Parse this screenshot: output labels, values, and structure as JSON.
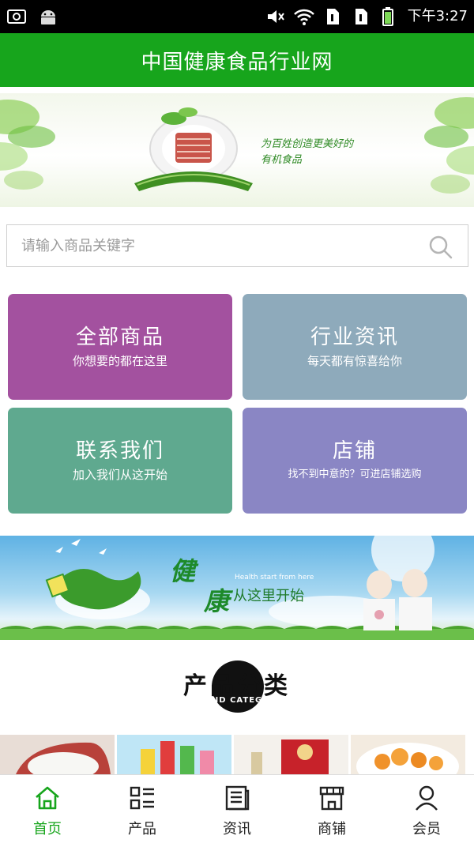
{
  "status_bar": {
    "time": "下午3:27",
    "icons": [
      "screenshot-icon",
      "android-icon",
      "mute-icon",
      "wifi-icon",
      "sim1-icon",
      "sim2-icon",
      "battery-icon"
    ]
  },
  "header": {
    "title": "中国健康食品行业网"
  },
  "banner_top": {
    "slogan_line1": "为百姓创造更美好的",
    "slogan_line2": "有机食品"
  },
  "search": {
    "placeholder": "请输入商品关键字",
    "value": ""
  },
  "tiles": [
    {
      "title": "全部商品",
      "subtitle": "你想要的都在这里",
      "color": "#a3519f"
    },
    {
      "title": "行业资讯",
      "subtitle": "每天都有惊喜给你",
      "color": "#8eaabb"
    },
    {
      "title": "联系我们",
      "subtitle": "加入我们从这开始",
      "color": "#5fa98f"
    },
    {
      "title": "店铺",
      "subtitle": "找不到中意的？可进店铺选购",
      "color": "#8a86c4"
    }
  ],
  "banner_mid": {
    "char1": "健",
    "char2": "康",
    "tagline": "从这里开始",
    "small_text": "Health start from here"
  },
  "category": {
    "title": "产品分类",
    "subtitle": "BRAND CATEGORY"
  },
  "bottom_nav": [
    {
      "label": "首页",
      "icon": "home-icon",
      "active": true
    },
    {
      "label": "产品",
      "icon": "grid-list-icon",
      "active": false
    },
    {
      "label": "资讯",
      "icon": "document-icon",
      "active": false
    },
    {
      "label": "商铺",
      "icon": "shop-icon",
      "active": false
    },
    {
      "label": "会员",
      "icon": "user-icon",
      "active": false
    }
  ],
  "colors": {
    "brand_green": "#17a51c",
    "status_bar": "#000000"
  }
}
